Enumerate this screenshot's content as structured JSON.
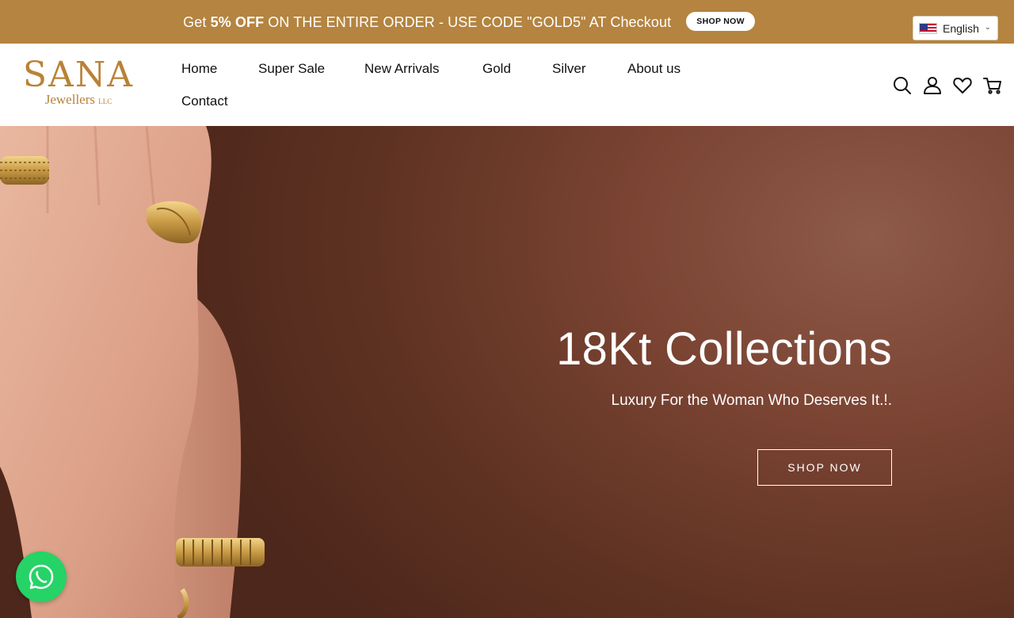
{
  "announcement": {
    "prefix": "Get ",
    "highlight": "5% OFF",
    "suffix": " ON THE ENTIRE ORDER - USE CODE \"GOLD5\" AT Checkout",
    "button_label": "SHOP NOW"
  },
  "language": {
    "selected": "English",
    "flag_icon": "us-flag-icon"
  },
  "logo": {
    "main": "SANA",
    "sub": "Jewellers",
    "suffix": "LLC"
  },
  "nav": {
    "items": [
      {
        "label": "Home"
      },
      {
        "label": "Super Sale"
      },
      {
        "label": "New Arrivals"
      },
      {
        "label": "Gold"
      },
      {
        "label": "Silver"
      },
      {
        "label": "About us"
      },
      {
        "label": "Contact"
      }
    ]
  },
  "header_icons": [
    "search-icon",
    "account-icon",
    "wishlist-icon",
    "cart-icon"
  ],
  "hero": {
    "title": "18Kt Collections",
    "subtitle": "Luxury For the Woman Who Deserves It.!.",
    "button_label": "SHOP NOW"
  },
  "colors": {
    "accent": "#b48440",
    "logo": "#b98235",
    "hero_bg": "#6a3a2a",
    "whatsapp": "#25d366"
  }
}
